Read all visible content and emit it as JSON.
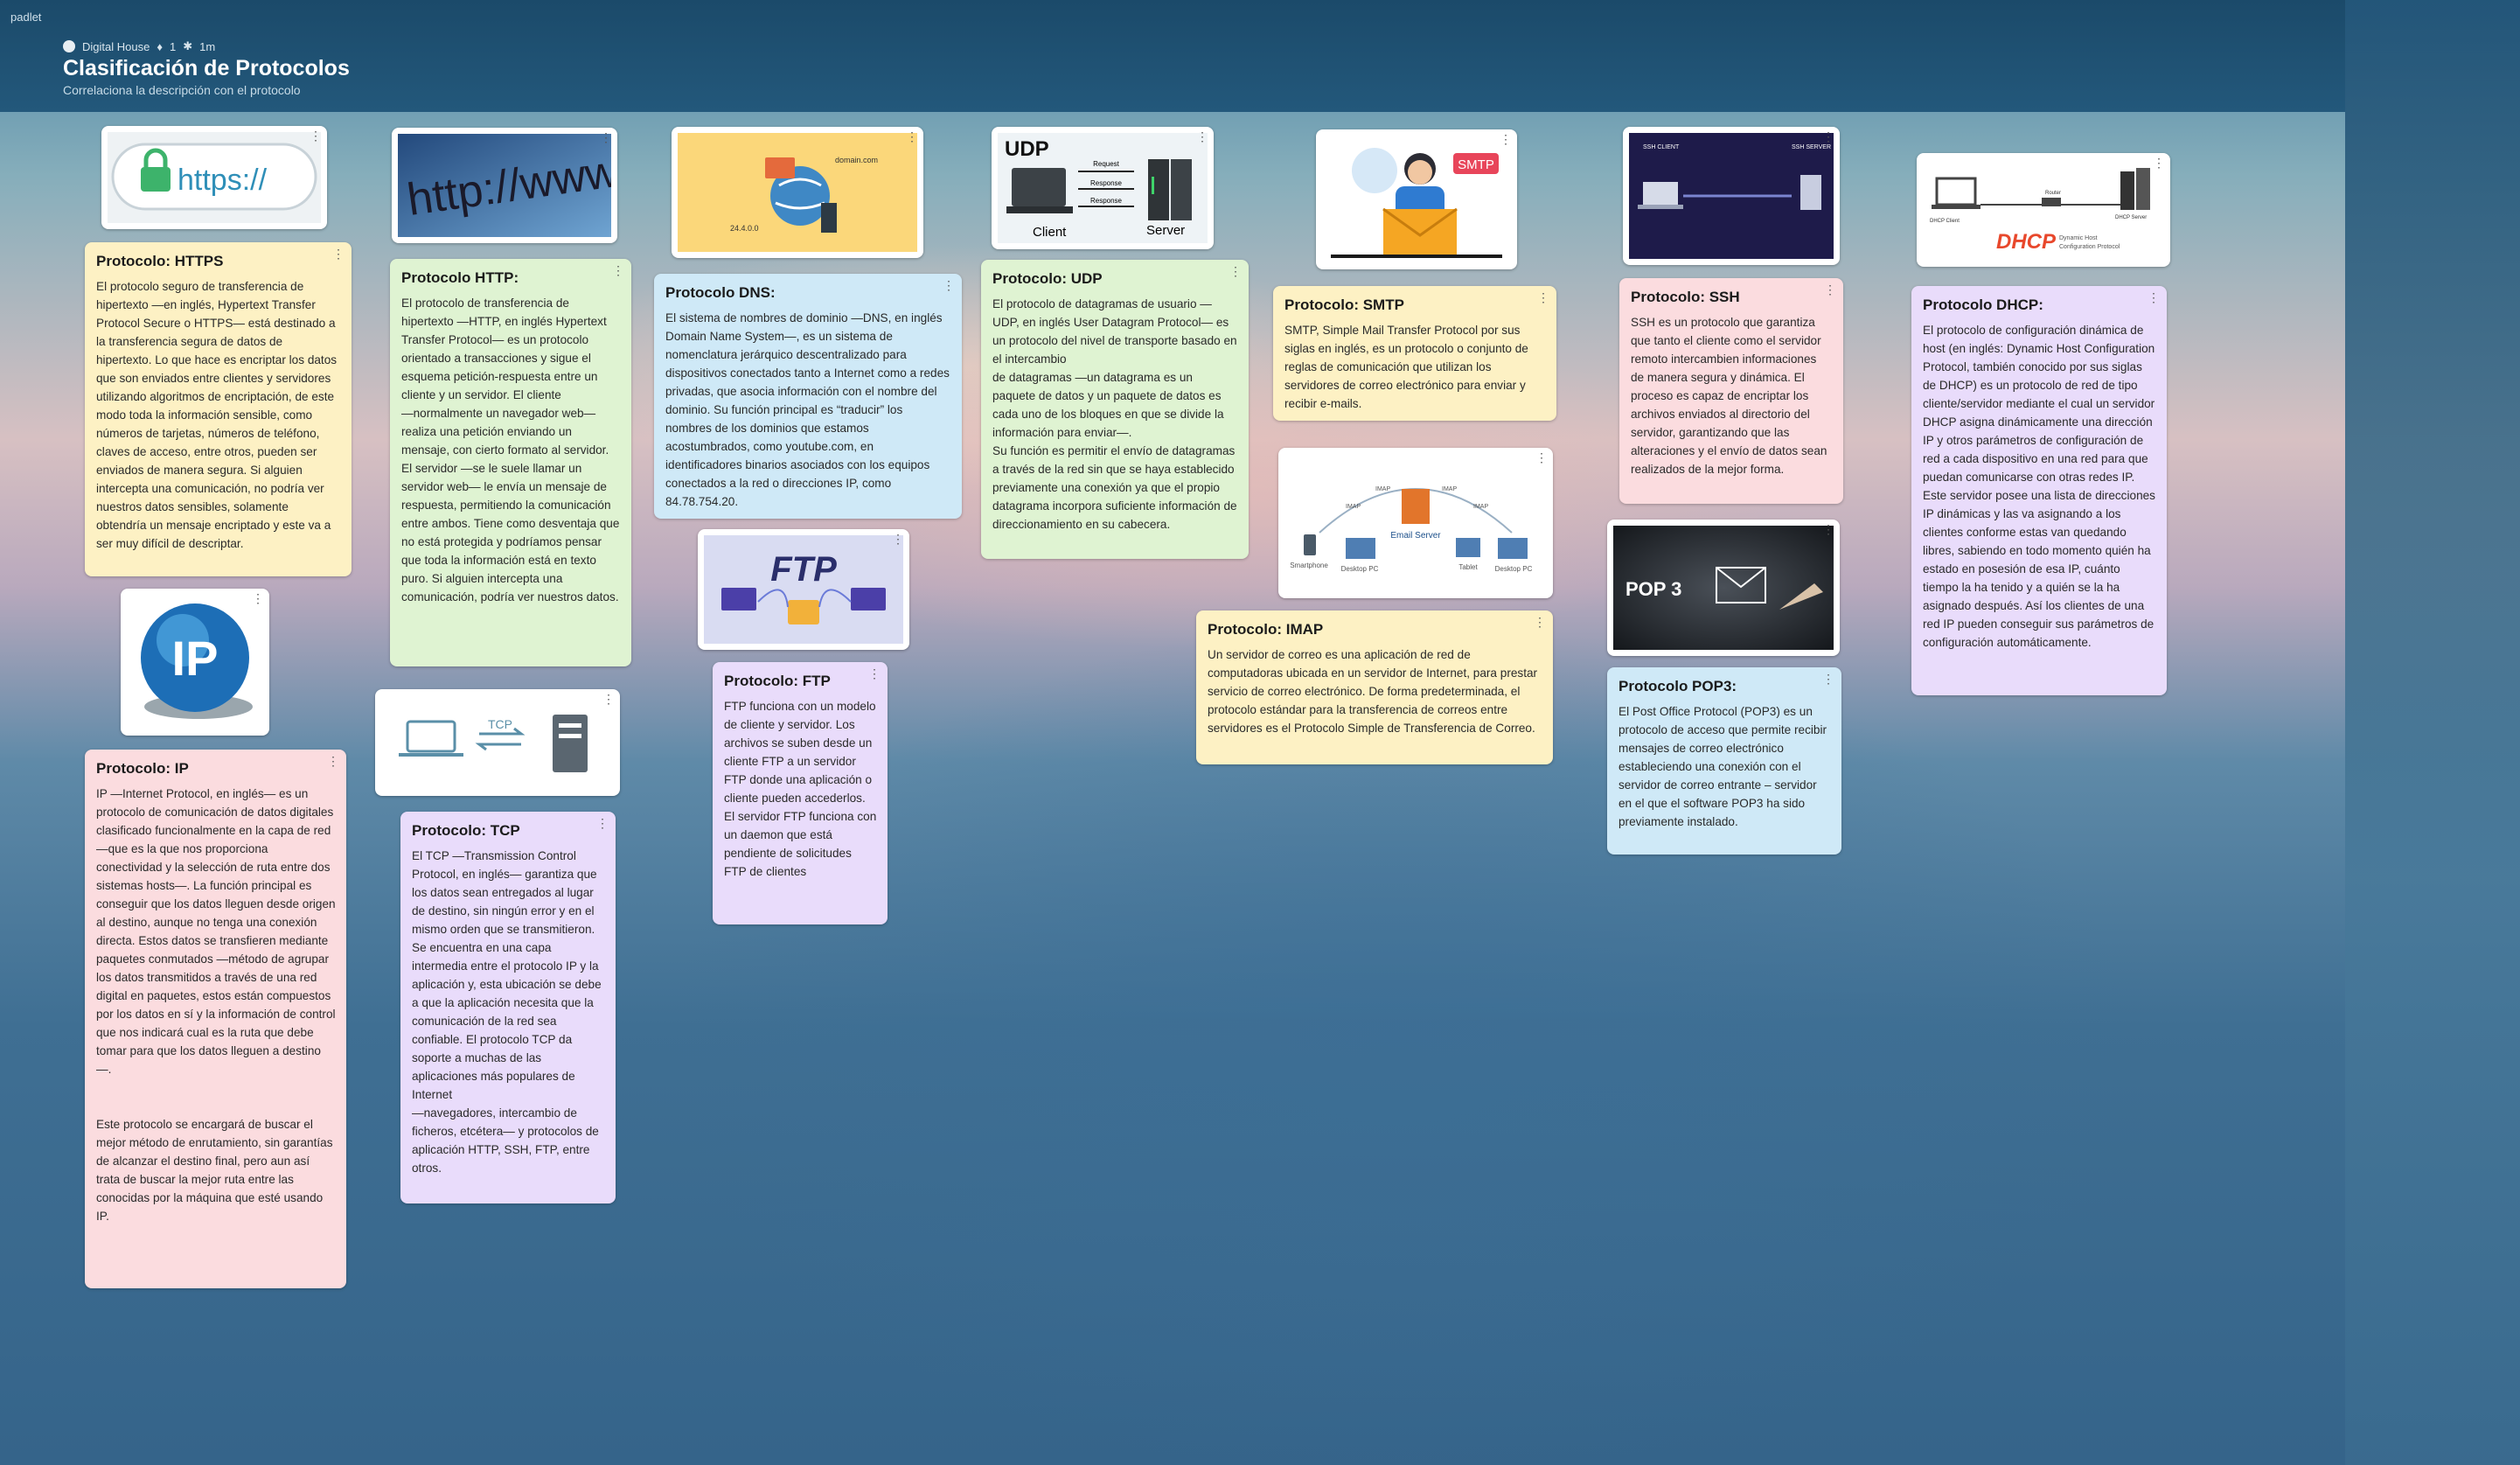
{
  "app": {
    "brand": "padlet"
  },
  "header": {
    "author": "Digital House",
    "likes": "1",
    "age": "1m",
    "title": "Clasificación de Protocolos",
    "subtitle": "Correlaciona la descripción con el protocolo"
  },
  "colors": {
    "yellow": "#fdf1c4",
    "green": "#dff3d2",
    "blue": "#cfe9f7",
    "purple": "#e9dcfb",
    "pink": "#fbdcdf",
    "header": "#1b4a6a"
  },
  "images": {
    "https": {
      "text": "https://"
    },
    "http": {
      "text": "http://www."
    },
    "dns": {
      "domain": "domain.com",
      "ip": "24.4.0.0"
    },
    "udp": {
      "title": "UDP",
      "request": "Request",
      "response1": "Response",
      "response2": "Response",
      "client": "Client",
      "server": "Server"
    },
    "smtp": {
      "badge": "SMTP"
    },
    "ssh": {
      "client": "SSH CLIENT",
      "server": "SSH SERVER"
    },
    "dhcp": {
      "logo": "DHCP",
      "caption1": "Dynamic Host",
      "caption2": "Configuration Protocol",
      "client": "DHCP Client",
      "server": "DHCP Server",
      "router": "Router"
    },
    "ip": {
      "text": "IP"
    },
    "tcp": {
      "text": "TCP"
    },
    "ftp": {
      "text": "FTP"
    },
    "imap": {
      "center": "Email Server",
      "n1": "Smartphone",
      "n2": "Desktop PC",
      "n3": "Tablet",
      "n4": "Desktop PC",
      "l1": "IMAP",
      "l2": "IMAP",
      "l3": "IMAP",
      "l4": "IMAP"
    },
    "pop3": {
      "text": "POP 3"
    }
  },
  "cards": {
    "https": {
      "title": "Protocolo: HTTPS",
      "body": "El protocolo seguro de transferencia de hipertexto —en inglés, Hypertext Transfer Protocol Secure o HTTPS— está destinado a la transferencia segura de datos de hipertexto. Lo que hace es encriptar los datos que son enviados entre clientes y servidores utilizando algoritmos de encriptación, de este modo toda la información sensible, como números de tarjetas, números de teléfono, claves de acceso, entre otros, pueden ser enviados de manera segura. Si alguien intercepta una comunicación, no podría ver nuestros datos sensibles, solamente obtendría un mensaje encriptado y este va a ser muy difícil de descriptar."
    },
    "http": {
      "title": "Protocolo HTTP:",
      "body": "El protocolo de transferencia de hipertexto —HTTP, en inglés Hypertext Transfer Protocol— es un protocolo orientado a transacciones y sigue el esquema petición-respuesta entre un cliente y un servidor. El cliente\n—normalmente un navegador web— realiza una petición enviando un mensaje, con cierto formato al servidor. El servidor —se le suele llamar un servidor web— le envía un mensaje de respuesta, permitiendo la comunicación entre ambos. Tiene como desventaja que no está protegida y podríamos pensar que toda la información está en texto puro. Si alguien intercepta una comunicación, podría ver nuestros datos."
    },
    "dns": {
      "title": "Protocolo DNS:",
      "body": "El sistema de nombres de dominio —DNS, en inglés Domain Name System—, es un sistema de nomenclatura jerárquico descentralizado para dispositivos conectados tanto a Internet como a redes privadas, que asocia información con el nombre del dominio. Su función principal es “traducir” los nombres de los dominios que estamos acostumbrados, como youtube.com, en identificadores binarios asociados con los equipos conectados a la red o direcciones IP, como 84.78.754.20."
    },
    "udp": {
      "title": "Protocolo: UDP",
      "body": "El protocolo de datagramas de usuario —UDP, en inglés User Datagram Protocol— es un protocolo del nivel de transporte basado en el intercambio\nde datagramas —un datagrama es un paquete de datos y un paquete de datos es cada uno de los bloques en que se divide la información para enviar—.\nSu función es permitir el envío de datagramas a través de la red sin que se haya establecido previamente una conexión ya que el propio datagrama incorpora suficiente información de direccionamiento en su cabecera."
    },
    "smtp": {
      "title": "Protocolo: SMTP",
      "body": "SMTP, Simple Mail Transfer Protocol por sus siglas en inglés, es un protocolo o conjunto de reglas de comunicación que utilizan los servidores de correo electrónico para enviar y recibir e-mails."
    },
    "ssh": {
      "title": "Protocolo: SSH",
      "body": "SSH es un protocolo que garantiza que tanto el cliente como el servidor remoto intercambien informaciones de manera segura y dinámica. El proceso es capaz de encriptar los archivos enviados al directorio del servidor, garantizando que las alteraciones y el envío de datos sean realizados de la mejor forma."
    },
    "dhcp": {
      "title": "Protocolo DHCP:",
      "body": "El protocolo de configuración dinámica de host (en inglés: Dynamic Host Configuration Protocol, también conocido por sus siglas de DHCP) es un protocolo de red de tipo cliente/servidor mediante el cual un servidor DHCP asigna dinámicamente una dirección IP y otros parámetros de configuración de red a cada dispositivo en una red para que puedan comunicarse con otras redes IP. Este servidor posee una lista de direcciones IP dinámicas y las va asignando a los clientes conforme estas van quedando libres, sabiendo en todo momento quién ha estado en posesión de esa IP, cuánto tiempo la ha tenido y a quién se la ha asignado después. Así los clientes de una red IP pueden conseguir sus parámetros de configuración automáticamente."
    },
    "ip": {
      "title": "Protocolo: IP",
      "body": "IP —Internet Protocol, en inglés— es un protocolo de comunicación de datos digitales clasificado funcionalmente en la capa de red —que es la que nos proporciona conectividad y la selección de ruta entre dos sistemas hosts—. La función principal es conseguir que los datos lleguen desde origen al destino, aunque no tenga una conexión directa. Estos datos se transfieren mediante paquetes conmutados —método de agrupar los datos transmitidos a través de una red digital en paquetes, estos están compuestos por los datos en sí y la información de control que nos indicará cual es la ruta que debe tomar para que los datos lleguen a destino—.\n\n\nEste protocolo se encargará de buscar el mejor método de enrutamiento, sin garantías de alcanzar el destino final, pero aun así trata de buscar la mejor ruta entre las conocidas por la máquina que esté usando IP."
    },
    "tcp": {
      "title": "Protocolo: TCP",
      "body": "El TCP —Transmission Control Protocol, en inglés— garantiza que los datos sean entregados al lugar de destino, sin ningún error y en el mismo orden que se transmitieron. Se encuentra en una capa intermedia entre el protocolo IP y la aplicación y, esta ubicación se debe a que la aplicación necesita que la comunicación de la red sea confiable. El protocolo TCP da soporte a muchas de las aplicaciones más populares de Internet\n—navegadores, intercambio de ficheros, etcétera— y protocolos de aplicación HTTP, SSH, FTP, entre otros."
    },
    "ftp": {
      "title": "Protocolo: FTP",
      "body": " FTP funciona con un modelo de cliente y servidor. Los archivos se suben desde un cliente FTP a un servidor FTP donde una aplicación o cliente pueden accederlos. El servidor FTP funciona con un daemon que está pendiente de solicitudes FTP de clientes"
    },
    "imap": {
      "title": "Protocolo: IMAP",
      "body": "Un servidor de correo es una aplicación de red de computadoras ubicada en un servidor de Internet, para prestar servicio de correo electrónico. De forma predeterminada, el protocolo estándar para la transferencia de correos entre servidores es el Protocolo Simple de Transferencia de Correo."
    },
    "pop3": {
      "title": "Protocolo POP3:",
      "body": "El Post Office Protocol (POP3) es un protocolo de acceso que permite recibir mensajes de correo electrónico estableciendo una conexión con el servidor de correo entrante – servidor en el que el software POP3 ha sido previamente instalado."
    }
  }
}
